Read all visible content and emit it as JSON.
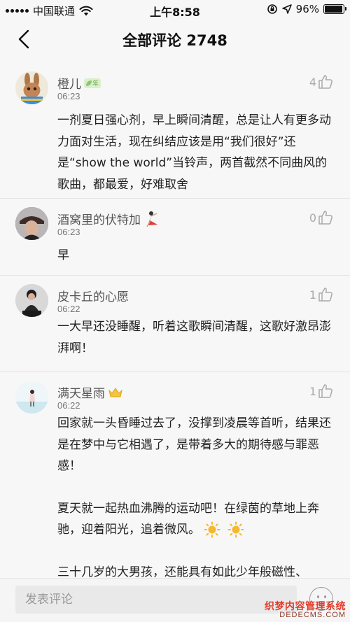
{
  "status_bar": {
    "carrier": "中国联通",
    "time": "上午8:58",
    "battery_text": "96%",
    "battery_level": 0.96
  },
  "nav": {
    "back_icon": "chevron-left-icon",
    "title": "全部评论 2748"
  },
  "comments": [
    {
      "username": "橙儿",
      "badge": "年",
      "time": "06:23",
      "likes": "4",
      "paragraphs": [
        "一剂夏日强心剂，早上瞬间清醒，总是让人有更多动力面对生活，现在纠结应该是用“我们很好”还是“show the world”当铃声，两首截然不同曲风的歌曲，都最爱，好难取舍"
      ]
    },
    {
      "username": "酒窝里的伏特加",
      "time": "06:23",
      "likes": "0",
      "paragraphs": [
        "早"
      ]
    },
    {
      "username": "皮卡丘的心愿",
      "time": "06:22",
      "likes": "1",
      "paragraphs": [
        "一大早还没睡醒，听着这歌瞬间清醒，这歌好激昂澎湃啊！"
      ]
    },
    {
      "username": "满天星雨",
      "time": "06:22",
      "likes": "1",
      "paragraphs": [
        "回家就一头昏睡过去了，没撑到凌晨等首听，结果还是在梦中与它相遇了，是带着多大的期待感与罪恶感！",
        "夏天就一起热血沸腾的运动吧！在绿茵的草地上奔驰，迎着阳光，追着微风。",
        "三十几岁的大男孩，还能具有如此少年般磁性、"
      ]
    }
  ],
  "input": {
    "placeholder": "发表评论"
  },
  "watermark": {
    "cn": "织梦内容管理系统",
    "en": "DEDECMS.COM"
  },
  "colors": {
    "background": "#f7f7f7",
    "text": "#222222",
    "secondary_text": "#777777",
    "divider": "#e4e4e4",
    "badge_green": "#6aa54a",
    "watermark_red": "#e23c2b"
  }
}
